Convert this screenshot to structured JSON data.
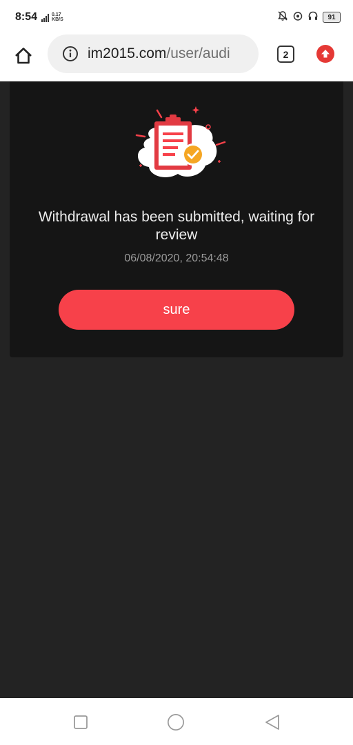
{
  "status_bar": {
    "time": "8:54",
    "net_speed_value": "0.17",
    "net_speed_unit": "KB/S",
    "battery": "91"
  },
  "browser": {
    "url_domain": "im2015.com",
    "url_path": "/user/audi",
    "tab_count": "2"
  },
  "dialog": {
    "message": "Withdrawal has been submitted, waiting for review",
    "timestamp": "06/08/2020, 20:54:48",
    "confirm_label": "sure"
  },
  "colors": {
    "accent": "#f7414a",
    "dialog_bg": "#151515",
    "page_bg": "#232323"
  }
}
